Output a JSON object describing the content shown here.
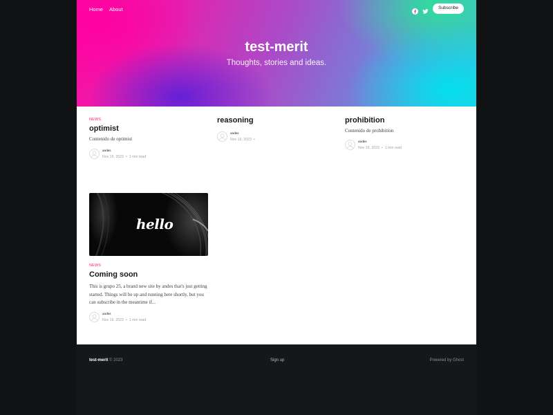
{
  "nav": {
    "links": [
      "Home",
      "About"
    ],
    "subscribe_label": "Subscribe",
    "social_icons": [
      "facebook-icon",
      "twitter-icon"
    ]
  },
  "site": {
    "title": "test-merit",
    "description": "Thoughts, stories and ideas."
  },
  "posts": [
    {
      "tag": "News",
      "title": "optimist",
      "excerpt": "Contenido de optimist",
      "author": "andes",
      "date": "Nov 19, 2023",
      "read_time": "1 min read"
    },
    {
      "tag": "",
      "title": "reasoning",
      "excerpt": "",
      "author": "andes",
      "date": "Nov 19, 2023",
      "read_time": ""
    },
    {
      "tag": "",
      "title": "prohibition",
      "excerpt": "Contenido de prohibition",
      "author": "andes",
      "date": "Nov 19, 2023",
      "read_time": "1 min read"
    },
    {
      "tag": "News",
      "title": "Coming soon",
      "excerpt": "This is grupo 25, a brand new site by andes that's just getting started. Things will be up and running here shortly, but you can subscribe in the meantime if...",
      "author": "andes",
      "date": "Nov 19, 2023",
      "read_time": "1 min read",
      "image_text": "hello"
    }
  ],
  "footer": {
    "site_name": "test-merit",
    "copyright": "© 2023",
    "signup_label": "Sign up",
    "powered_by": "Powered by Ghost"
  },
  "colors": {
    "accent": "#ff1a75",
    "dark": "#15171a"
  }
}
